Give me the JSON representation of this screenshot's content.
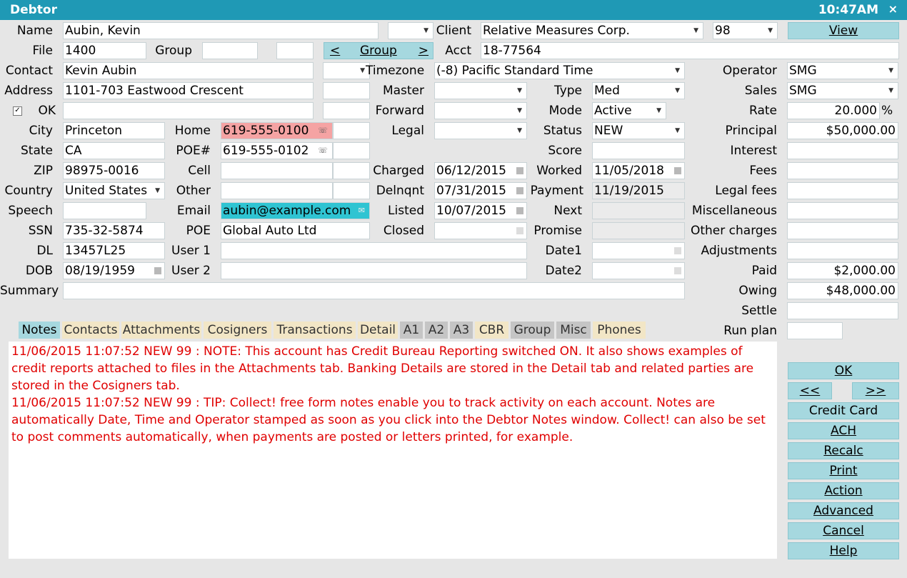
{
  "window": {
    "title": "Debtor",
    "clock": "10:47AM",
    "close": "×"
  },
  "labels": {
    "name": "Name",
    "file": "File",
    "group": "Group",
    "contact": "Contact",
    "address": "Address",
    "ok": "OK",
    "city": "City",
    "state": "State",
    "zip": "ZIP",
    "country": "Country",
    "speech": "Speech",
    "ssn": "SSN",
    "dl": "DL",
    "dob": "DOB",
    "summary": "Summary",
    "client": "Client",
    "acct": "Acct",
    "timezone": "Timezone",
    "master": "Master",
    "forward": "Forward",
    "legal": "Legal",
    "home": "Home",
    "poe_num": "POE#",
    "cell": "Cell",
    "other": "Other",
    "email": "Email",
    "poe": "POE",
    "user1": "User 1",
    "user2": "User 2",
    "charged": "Charged",
    "delnqnt": "Delnqnt",
    "listed": "Listed",
    "closed": "Closed",
    "type": "Type",
    "mode": "Mode",
    "status": "Status",
    "score": "Score",
    "worked": "Worked",
    "payment": "Payment",
    "next": "Next",
    "promise": "Promise",
    "date1": "Date1",
    "date2": "Date2",
    "operator": "Operator",
    "sales": "Sales",
    "rate": "Rate",
    "principal": "Principal",
    "interest": "Interest",
    "fees": "Fees",
    "legal_fees": "Legal fees",
    "misc": "Miscellaneous",
    "other_charges": "Other charges",
    "adjustments": "Adjustments",
    "paid": "Paid",
    "owing": "Owing",
    "settle": "Settle",
    "run_plan": "Run plan"
  },
  "values": {
    "name": "Aubin, Kevin",
    "file": "1400",
    "contact": "Kevin Aubin",
    "address": "1101-703 Eastwood Crescent",
    "city": "Princeton",
    "state": "CA",
    "zip": "98975-0016",
    "country": "United States",
    "ssn": "735-32-5874",
    "dl": "13457L25",
    "dob": "08/19/1959",
    "client": "Relative Measures Corp.",
    "client_num": "98",
    "acct": "18-77564",
    "timezone": "(-8) Pacific Standard Time",
    "home": "619-555-0100",
    "poe_num": "619-555-0102",
    "email": "aubin@example.com",
    "poe": "Global Auto Ltd",
    "charged": "06/12/2015",
    "delnqnt": "07/31/2015",
    "listed": "10/07/2015",
    "type": "Med",
    "mode": "Active",
    "status": "NEW",
    "worked": "11/05/2018",
    "payment": "11/19/2015",
    "operator": "SMG",
    "sales": "SMG",
    "rate": "20.000",
    "rate_unit": "%",
    "principal": "$50,000.00",
    "paid": "$2,000.00",
    "owing": "$48,000.00"
  },
  "group_nav": {
    "prev": "<",
    "label": "Group",
    "next": ">"
  },
  "buttons": {
    "view": "View",
    "ok": "OK",
    "prev": "<<",
    "next": ">>",
    "credit_card": "Credit Card",
    "ach": "ACH",
    "recalc": "Recalc",
    "print": "Print",
    "action": "Action",
    "advanced": "Advanced",
    "cancel": "Cancel",
    "help": "Help"
  },
  "tabs": [
    "Notes",
    "Contacts",
    "Attachments",
    "Cosigners",
    "Transactions",
    "Detail",
    "A1",
    "A2",
    "A3",
    "CBR",
    "Group",
    "Misc",
    "Phones"
  ],
  "notes": [
    "11/06/2015 11:07:52 NEW 99 : NOTE: This account has Credit Bureau Reporting switched ON. It also shows examples of credit reports attached to files in the Attachments tab. Banking Details are stored in the Detail tab and related parties are stored in the Cosigners tab.",
    "11/06/2015 11:07:52 NEW 99 : TIP: Collect! free form notes enable you to track activity on each account. Notes are automatically Date, Time and Operator stamped as soon as you click into the Debtor Notes window. Collect! can also be set to post comments automatically, when payments are posted or letters printed, for example."
  ],
  "checkbox": {
    "ok_checked": "✓"
  },
  "colors": {
    "title_bar": "#1f99b5",
    "button": "#a6d8df",
    "notes_text": "#e00000",
    "home_highlight": "#f5a3a3",
    "email_highlight": "#2fc4d2"
  }
}
